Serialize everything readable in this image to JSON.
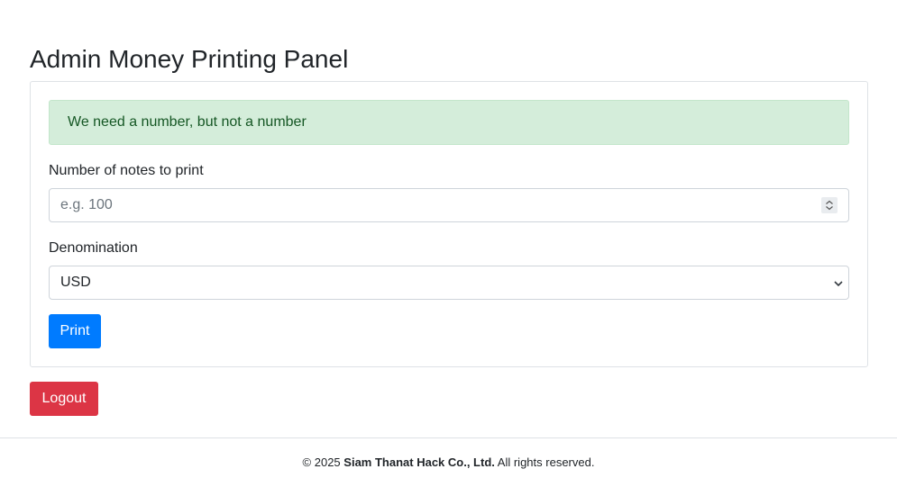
{
  "page": {
    "title": "Admin Money Printing Panel"
  },
  "alert": {
    "message": "We need a number, but not a number",
    "color": "#d4edda"
  },
  "form": {
    "notes_label": "Number of notes to print",
    "notes_placeholder": "e.g. 100",
    "notes_value": "",
    "denomination_label": "Denomination",
    "denomination_selected": "USD",
    "print_label": "Print",
    "print_color": "#007bff"
  },
  "logout": {
    "label": "Logout",
    "color": "#dc3545"
  },
  "footer": {
    "prefix": "© 2025",
    "company": "Siam Thanat Hack Co., Ltd.",
    "suffix": "All rights reserved."
  },
  "icons": {
    "number_spinner": "spinner-updown-icon",
    "select_arrow": "chevron-down-icon"
  }
}
